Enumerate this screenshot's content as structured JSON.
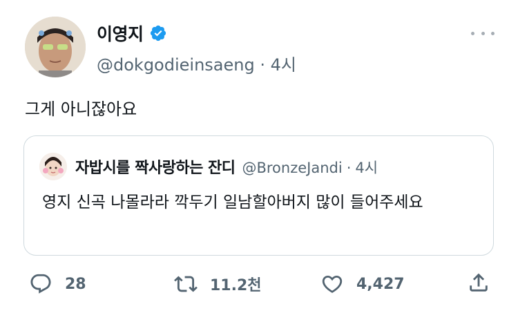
{
  "tweet": {
    "author_name": "이영지",
    "author_handle": "@dokgodieinsaeng",
    "separator": "·",
    "time": "4시",
    "text": "그게 아니잖아요"
  },
  "quote": {
    "author_name": "자밥시를 짝사랑하는 잔디",
    "author_handle": "@BronzeJandi",
    "separator": "·",
    "time": "4시",
    "text": "영지 신곡 나몰라라 깍두기 일남할아버지 많이 들어주세요"
  },
  "actions": {
    "replies": "28",
    "retweets": "11.2천",
    "likes": "4,427"
  },
  "colors": {
    "verified": "#1d9bf0",
    "secondary_text": "#536471",
    "border": "#cfd9de"
  },
  "icons": [
    "verified-badge-icon",
    "more-icon",
    "reply-icon",
    "retweet-icon",
    "like-icon",
    "share-icon"
  ]
}
